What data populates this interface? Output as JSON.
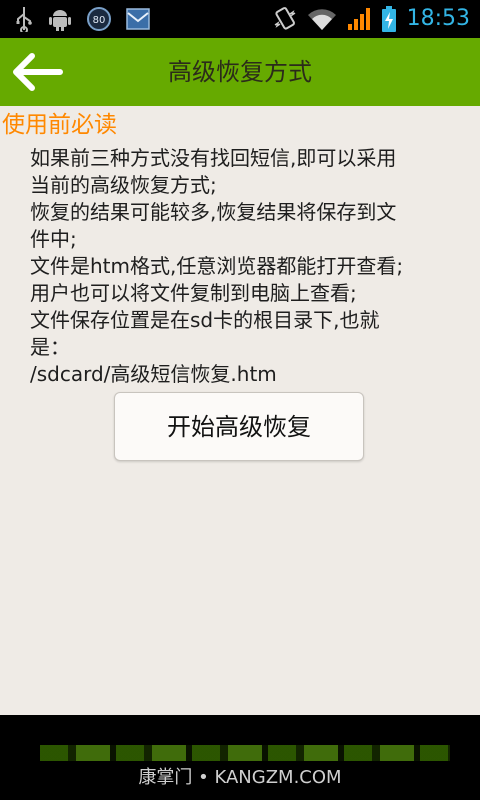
{
  "status_bar": {
    "time": "18:53",
    "icons": [
      "usb-icon",
      "android-debug-icon",
      "battery-80-badge-icon",
      "mail-icon",
      "vibrate-icon",
      "wifi-icon",
      "signal-icon",
      "battery-charging-icon"
    ],
    "badge_value": "80",
    "accent_color": "#33b5e5"
  },
  "app_bar": {
    "title": "高级恢复方式",
    "background_color": "#66aa00"
  },
  "section": {
    "title": "使用前必读",
    "title_color": "#ff8800"
  },
  "body_lines": [
    "如果前三种方式没有找回短信,即可以采用",
    "当前的高级恢复方式;",
    "恢复的结果可能较多,恢复结果将保存到文",
    "件中;",
    "文件是htm格式,任意浏览器都能打开查看;",
    "用户也可以将文件复制到电脑上查看;",
    "文件保存位置是在sd卡的根目录下,也就",
    "是：",
    "/sdcard/高级短信恢复.htm"
  ],
  "start_button": {
    "label": "开始高级恢复"
  },
  "watermark": {
    "text": "康掌门 • KANGZM.COM"
  }
}
